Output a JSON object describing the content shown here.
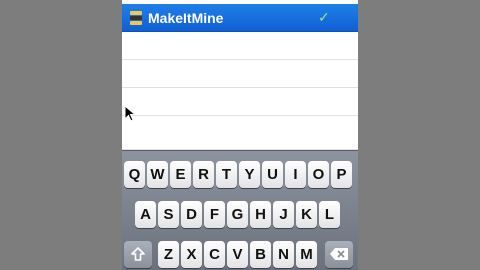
{
  "list": {
    "selected_item": {
      "label": "MakeItMine",
      "icon": "drive-icon",
      "checkmark": "✓"
    },
    "empty_rows": 4
  },
  "keyboard": {
    "row1": [
      "Q",
      "W",
      "E",
      "R",
      "T",
      "Y",
      "U",
      "I",
      "O",
      "P"
    ],
    "row2": [
      "A",
      "S",
      "D",
      "F",
      "G",
      "H",
      "J",
      "K",
      "L"
    ],
    "row3": [
      "Z",
      "X",
      "C",
      "V",
      "B",
      "N",
      "M"
    ],
    "shift_icon": "shift-icon",
    "backspace_icon": "backspace-icon"
  },
  "colors": {
    "selection": "#1f7fe8",
    "checkmark": "#9be37b",
    "keyboard_bg": "#7b828d"
  }
}
